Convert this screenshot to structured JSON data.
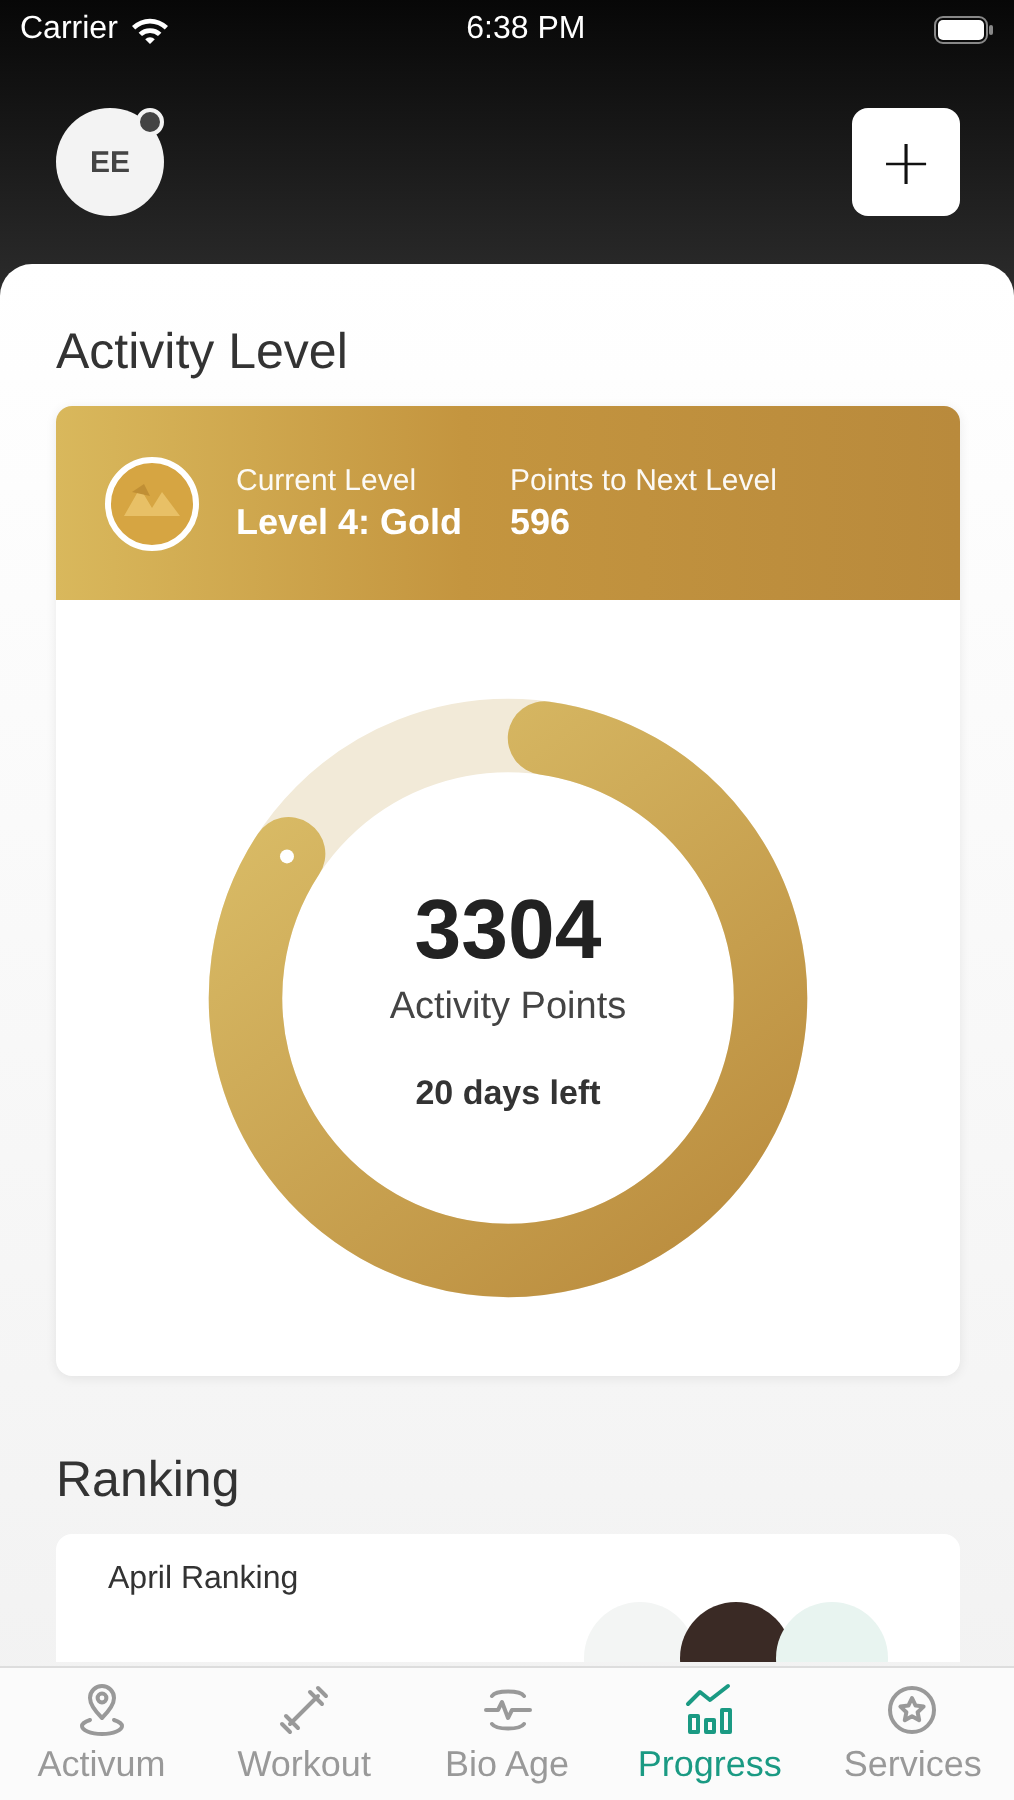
{
  "status_bar": {
    "carrier": "Carrier",
    "time": "6:38 PM"
  },
  "header": {
    "avatar_initials": "EE",
    "notification_dot": true,
    "add_button": "+"
  },
  "activity": {
    "title": "Activity Level",
    "level_labels": [
      {
        "label": "Current Level",
        "value": "Level 4: Gold"
      },
      {
        "label": "Points to Next Level",
        "value": "596"
      }
    ],
    "points": "3304",
    "points_label": "Activity Points",
    "days_left": "20 days left",
    "level": 0.82
  },
  "ranking": {
    "title": "Ranking",
    "card_label": "April Ranking"
  },
  "tabs": [
    {
      "label": "Activum",
      "selected": false
    },
    {
      "label": "Workout",
      "selected": false
    },
    {
      "label": "Bio Age",
      "selected": false
    },
    {
      "label": "Progress",
      "selected": true
    },
    {
      "label": "Services",
      "selected": false
    }
  ]
}
